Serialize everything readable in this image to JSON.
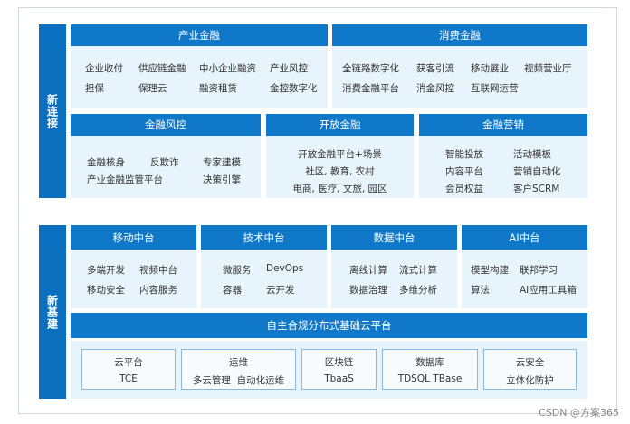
{
  "new_connection": {
    "label": "新连接",
    "industry_finance": {
      "title": "产业金融",
      "items": [
        "企业收付",
        "供应链金融",
        "中小企业融资",
        "产业风控",
        "担保",
        "保理云",
        "融资租赁",
        "金控数字化"
      ]
    },
    "consumer_finance": {
      "title": "消费金融",
      "items": [
        "全链路数字化",
        "获客引流",
        "移动展业",
        "视频营业厅",
        "消费金融平台",
        "消金风控",
        "互联网运营"
      ]
    },
    "risk_control": {
      "title": "金融风控",
      "items": [
        "金融核身",
        "反欺诈",
        "专家建模",
        "产业金融监管平台",
        "决策引擎"
      ]
    },
    "open_finance": {
      "title": "开放金融",
      "lines": [
        "开放金融平台+场景",
        "社区, 教育, 农村",
        "电商, 医疗, 文旅, 园区"
      ]
    },
    "finance_marketing": {
      "title": "金融营销",
      "items": [
        "智能投放",
        "活动模板",
        "内容平台",
        "营销自动化",
        "会员权益",
        "客户SCRM"
      ]
    }
  },
  "new_infrastructure": {
    "label": "新基建",
    "mobile": {
      "title": "移动中台",
      "items": [
        "多端开发",
        "视频中台",
        "移动安全",
        "内容服务"
      ]
    },
    "tech": {
      "title": "技术中台",
      "items": [
        "微服务",
        "DevOps",
        "容器",
        "云开发"
      ]
    },
    "data": {
      "title": "数据中台",
      "items": [
        "离线计算",
        "流式计算",
        "数据治理",
        "多维分析"
      ]
    },
    "ai": {
      "title": "AI中台",
      "items": [
        "模型构建",
        "联邦学习",
        "算法",
        "AI应用工具箱"
      ]
    },
    "cloud_platform_title": "自主合规分布式基础云平台",
    "bottom": [
      {
        "title": "云平台",
        "line": "TCE"
      },
      {
        "title": "运维",
        "line": "多云管理  自动化运维"
      },
      {
        "title": "区块链",
        "line": "TbaaS"
      },
      {
        "title": "数据库",
        "line": "TDSQL TBase"
      },
      {
        "title": "云安全",
        "line": "立体化防护"
      }
    ]
  },
  "watermark": "CSDN @方案365"
}
